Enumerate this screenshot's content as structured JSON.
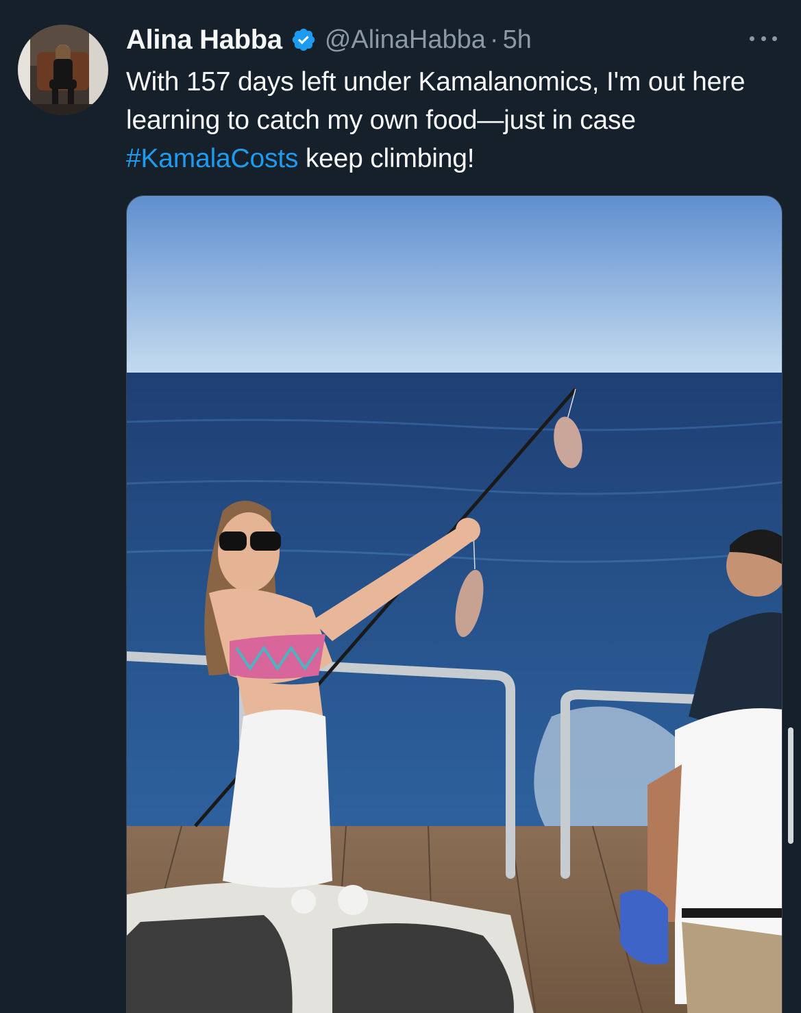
{
  "tweet": {
    "author_name": "Alina Habba",
    "handle": "@AlinaHabba",
    "separator": "·",
    "time": "5h",
    "text_before_hashtag": "With 157 days left under Kamalanomics, I'm out here learning to catch my own food—just in case ",
    "hashtag": "#KamalaCosts",
    "text_after_hashtag": " keep climbing!",
    "verified": true
  },
  "icons": {
    "verified": "verified-badge-icon",
    "more": "more-horizontal-icon"
  },
  "colors": {
    "background": "#15202b",
    "text": "#f7f9f9",
    "secondary_text": "#8b98a5",
    "accent": "#1d9bf0"
  }
}
